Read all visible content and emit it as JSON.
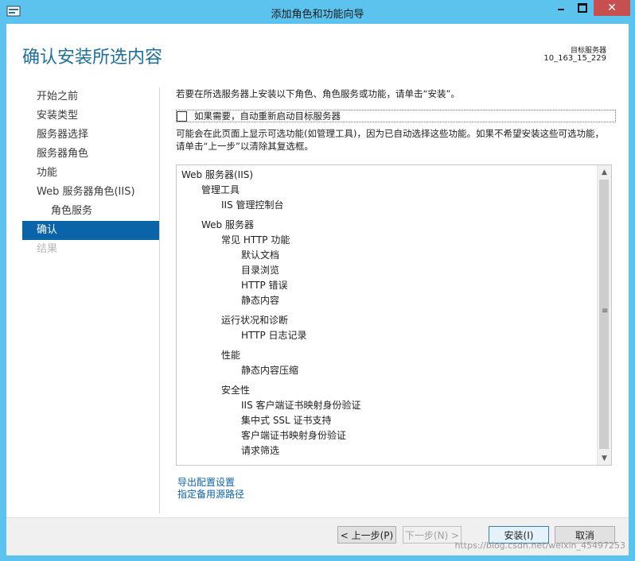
{
  "window": {
    "title": "添加角色和功能向导",
    "minimize": "—",
    "maximize": "□",
    "close": "✕",
    "app_icon": "server-manager-icon"
  },
  "header": {
    "page_title": "确认安装所选内容",
    "target_label": "目标服务器",
    "target_name": "10_163_15_229"
  },
  "nav": {
    "items": [
      {
        "label": "开始之前",
        "state": "normal"
      },
      {
        "label": "安装类型",
        "state": "normal"
      },
      {
        "label": "服务器选择",
        "state": "normal"
      },
      {
        "label": "服务器角色",
        "state": "normal"
      },
      {
        "label": "功能",
        "state": "normal"
      },
      {
        "label": "Web 服务器角色(IIS)",
        "state": "normal"
      },
      {
        "label": "角色服务",
        "state": "sub"
      },
      {
        "label": "确认",
        "state": "active"
      },
      {
        "label": "结果",
        "state": "disabled"
      }
    ]
  },
  "main": {
    "intro": "若要在所选服务器上安装以下角色、角色服务或功能，请单击“安装”。",
    "restart_checkbox": {
      "label": "如果需要，自动重新启动目标服务器",
      "checked": false
    },
    "note": "可能会在此页面上显示可选功能(如管理工具)，因为已自动选择这些功能。如果不希望安装这些可选功能，请单击“上一步”以清除其复选框。",
    "tree": [
      {
        "text": "Web 服务器(IIS)",
        "level": 0
      },
      {
        "text": "管理工具",
        "level": 1
      },
      {
        "text": "IIS 管理控制台",
        "level": 2
      },
      {
        "gap": true
      },
      {
        "text": "Web 服务器",
        "level": 1
      },
      {
        "text": "常见 HTTP 功能",
        "level": 2
      },
      {
        "text": "默认文档",
        "level": 3
      },
      {
        "text": "目录浏览",
        "level": 3
      },
      {
        "text": "HTTP 错误",
        "level": 3
      },
      {
        "text": "静态内容",
        "level": 3
      },
      {
        "gap": true
      },
      {
        "text": "运行状况和诊断",
        "level": 2
      },
      {
        "text": "HTTP 日志记录",
        "level": 3
      },
      {
        "gap": true
      },
      {
        "text": "性能",
        "level": 2
      },
      {
        "text": "静态内容压缩",
        "level": 3
      },
      {
        "gap": true
      },
      {
        "text": "安全性",
        "level": 2
      },
      {
        "text": "IIS 客户端证书映射身份验证",
        "level": 3
      },
      {
        "text": "集中式 SSL 证书支持",
        "level": 3
      },
      {
        "text": "客户端证书映射身份验证",
        "level": 3
      },
      {
        "text": "请求筛选",
        "level": 3
      }
    ],
    "links": {
      "export": "导出配置设置",
      "alt_source": "指定备用源路径"
    }
  },
  "footer": {
    "prev": "< 上一步(P)",
    "next": "下一步(N) >",
    "install": "安装(I)",
    "cancel": "取消"
  },
  "watermark": "https://blog.csdn.net/weixin_45497253"
}
